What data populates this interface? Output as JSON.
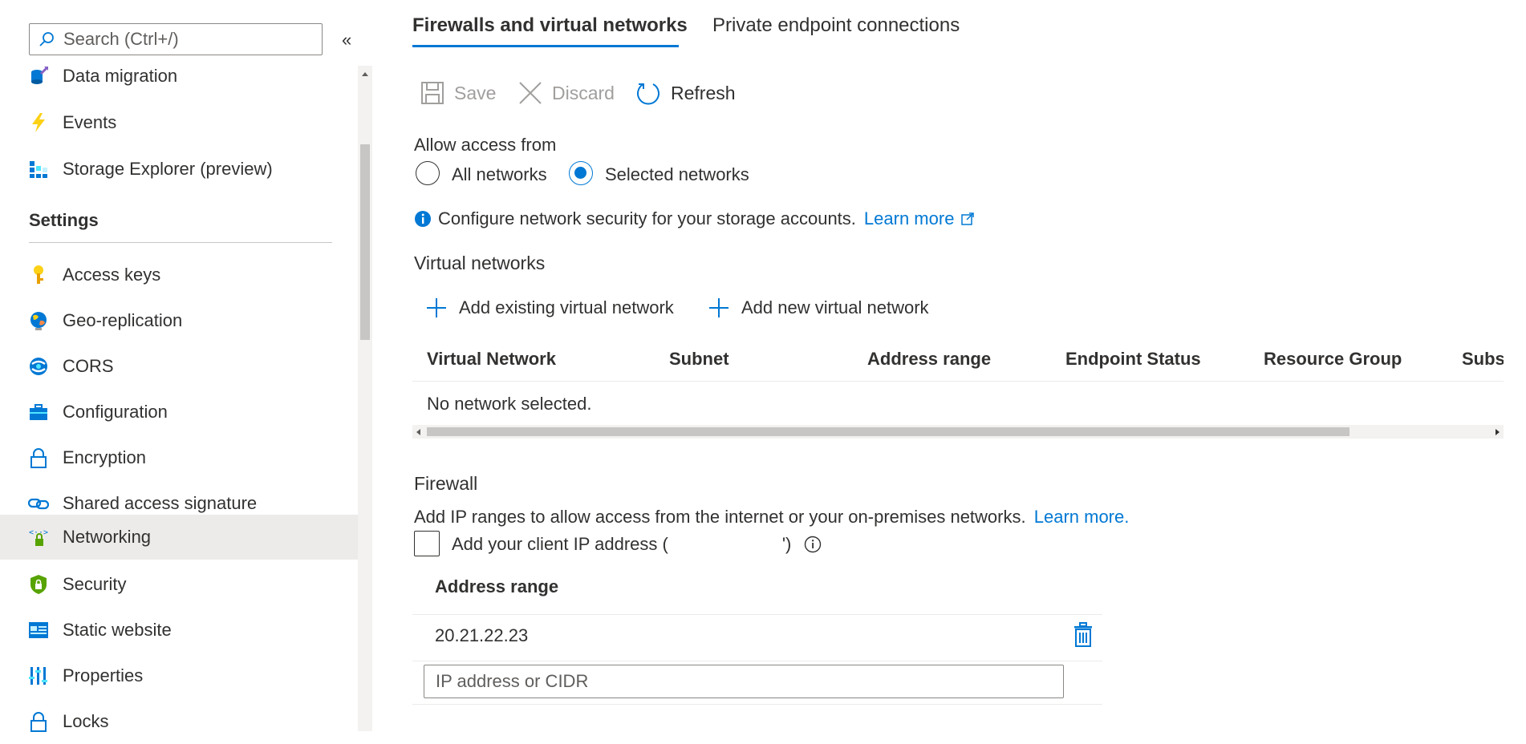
{
  "sidebar": {
    "search": {
      "placeholder": "Search (Ctrl+/)",
      "icon": "search-icon"
    },
    "collapse_label": "«",
    "items_top": [
      {
        "label": "Data migration",
        "icon": "data-migration-icon"
      },
      {
        "label": "Events",
        "icon": "lightning-icon"
      },
      {
        "label": "Storage Explorer (preview)",
        "icon": "storage-explorer-icon"
      }
    ],
    "settings_header": "Settings",
    "settings_items": [
      {
        "label": "Access keys",
        "icon": "key-icon"
      },
      {
        "label": "Geo-replication",
        "icon": "globe-icon"
      },
      {
        "label": "CORS",
        "icon": "cors-icon"
      },
      {
        "label": "Configuration",
        "icon": "briefcase-icon"
      },
      {
        "label": "Encryption",
        "icon": "lock-icon"
      },
      {
        "label": "Shared access signature",
        "icon": "link-icon"
      },
      {
        "label": "Networking",
        "icon": "networking-icon",
        "selected": true
      },
      {
        "label": "Security",
        "icon": "shield-icon"
      },
      {
        "label": "Static website",
        "icon": "static-website-icon"
      },
      {
        "label": "Properties",
        "icon": "properties-icon"
      },
      {
        "label": "Locks",
        "icon": "lock-icon"
      }
    ]
  },
  "tabs": [
    {
      "label": "Firewalls and virtual networks",
      "active": true
    },
    {
      "label": "Private endpoint connections",
      "active": false
    }
  ],
  "toolbar": {
    "save_label": "Save",
    "discard_label": "Discard",
    "refresh_label": "Refresh"
  },
  "access": {
    "title": "Allow access from",
    "options": [
      {
        "label": "All networks",
        "checked": false
      },
      {
        "label": "Selected networks",
        "checked": true
      }
    ]
  },
  "info": {
    "text": "Configure network security for your storage accounts.",
    "link": "Learn more"
  },
  "vnet": {
    "title": "Virtual networks",
    "add_existing": "Add existing virtual network",
    "add_new": "Add new virtual network",
    "columns": [
      "Virtual Network",
      "Subnet",
      "Address range",
      "Endpoint Status",
      "Resource Group",
      "Subsc"
    ],
    "empty_text": "No network selected."
  },
  "firewall": {
    "title": "Firewall",
    "description": "Add IP ranges to allow access from the internet or your on-premises networks.",
    "link": "Learn more.",
    "client_ip_prefix": "Add your client IP address (",
    "client_ip_suffix": "')",
    "client_ip_checked": false,
    "column": "Address range",
    "rows": [
      "20.21.22.23"
    ],
    "input_placeholder": "IP address or CIDR"
  },
  "colors": {
    "accent": "#0078d4",
    "selected_bg": "#edebe9",
    "text": "#323130",
    "disabled": "#a19f9d"
  }
}
